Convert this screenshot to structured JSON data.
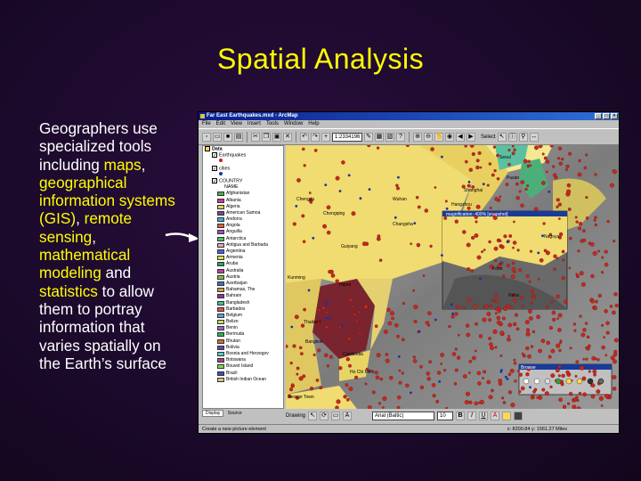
{
  "slide": {
    "title": "Spatial Analysis",
    "body": {
      "t1": "Geographers use specialized tools including ",
      "maps": "maps",
      "t2": ", ",
      "gis": "geographical information systems (GIS)",
      "t3": ", ",
      "remote": "remote sensing",
      "t4": ", ",
      "math": "mathematical modeling",
      "t5": " and ",
      "stats": "statistics",
      "t6": " to allow them to portray information that varies spatially on the Earth’s surface"
    },
    "colors": {
      "title": "#ffff00",
      "text": "#ffffff",
      "highlight": "#ffff00"
    }
  },
  "window": {
    "title": "Far East Earthquakes.mxd - ArcMap",
    "menu": [
      "File",
      "Edit",
      "View",
      "Insert",
      "Tools",
      "Window",
      "Help"
    ],
    "scale": "1:2334196",
    "select_label": "Select",
    "toc": {
      "data_frame": "Data",
      "layers": [
        "Earthquakes",
        "cities",
        "COUNTRY"
      ],
      "field": "NAME",
      "countries": [
        {
          "name": "Afghanistan",
          "color": "#4caf50"
        },
        {
          "name": "Albania",
          "color": "#d13a8e"
        },
        {
          "name": "Algeria",
          "color": "#e0d060"
        },
        {
          "name": "American Samoa",
          "color": "#6b4aa8"
        },
        {
          "name": "Andorra",
          "color": "#40b0c8"
        },
        {
          "name": "Angola",
          "color": "#e06030"
        },
        {
          "name": "Anguilla",
          "color": "#a050c0"
        },
        {
          "name": "Antarctica",
          "color": "#50c060"
        },
        {
          "name": "Antigua and Barbuda",
          "color": "#e8a0c0"
        },
        {
          "name": "Argentina",
          "color": "#5060d0"
        },
        {
          "name": "Armenia",
          "color": "#e0e040"
        },
        {
          "name": "Aruba",
          "color": "#30a070"
        },
        {
          "name": "Australia",
          "color": "#c040a0"
        },
        {
          "name": "Austria",
          "color": "#80c040"
        },
        {
          "name": "Azerbaijan",
          "color": "#4070c0"
        },
        {
          "name": "Bahamas, The",
          "color": "#d0a040"
        },
        {
          "name": "Bahrain",
          "color": "#9030a0"
        },
        {
          "name": "Bangladesh",
          "color": "#40c090"
        },
        {
          "name": "Barbados",
          "color": "#e05050"
        },
        {
          "name": "Belgium",
          "color": "#60a0e0"
        },
        {
          "name": "Belize",
          "color": "#c0e060"
        },
        {
          "name": "Benin",
          "color": "#a060d0"
        },
        {
          "name": "Bermuda",
          "color": "#30b050"
        },
        {
          "name": "Bhutan",
          "color": "#d07030"
        },
        {
          "name": "Bolivia",
          "color": "#7040b0"
        },
        {
          "name": "Bosnia and Herzegov",
          "color": "#50d0c0"
        },
        {
          "name": "Botswana",
          "color": "#b04080"
        },
        {
          "name": "Bouvet Island",
          "color": "#90d050"
        },
        {
          "name": "Brazil",
          "color": "#4050b0"
        },
        {
          "name": "British Indian Ocean",
          "color": "#e0c080"
        }
      ],
      "tabs": [
        "Display",
        "Source"
      ]
    },
    "map": {
      "labels": [
        "Chengdu",
        "Chongqing",
        "Wuhan",
        "Changsha",
        "Shanghai",
        "Hangzhou",
        "Seoul",
        "Pusan",
        "Guiyang",
        "Kunming",
        "Hanoi",
        "Thailand",
        "Cambodia",
        "Bangkok",
        "Ho Chi Minh",
        "George Town",
        "Kobe",
        "Nagoya",
        "Naha"
      ],
      "magnifier_title": "magnification: 400% [snapshot]",
      "browse_title": "Browse"
    },
    "draw_toolbar": {
      "label": "Drawing",
      "font": "Arial (Baltic)",
      "font_size": "10"
    },
    "status": {
      "message": "Create a new picture element",
      "coords": "x: 8200.84  y: 1561.27 Miles"
    }
  }
}
